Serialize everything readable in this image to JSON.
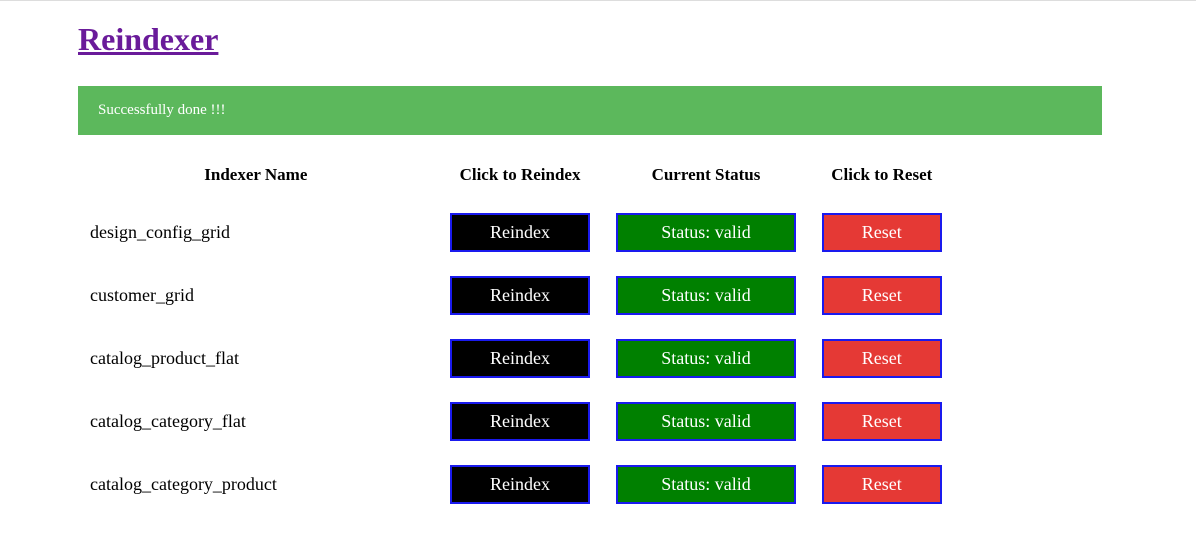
{
  "page": {
    "title": "Reindexer"
  },
  "banner": {
    "message": "Successfully done !!!"
  },
  "table": {
    "headers": {
      "name": "Indexer Name",
      "reindex": "Click to Reindex",
      "status": "Current Status",
      "reset": "Click to Reset"
    },
    "reindex_label": "Reindex",
    "reset_label": "Reset",
    "status_prefix": "Status: ",
    "rows": [
      {
        "name": "design_config_grid",
        "status": "valid"
      },
      {
        "name": "customer_grid",
        "status": "valid"
      },
      {
        "name": "catalog_product_flat",
        "status": "valid"
      },
      {
        "name": "catalog_category_flat",
        "status": "valid"
      },
      {
        "name": "catalog_category_product",
        "status": "valid"
      }
    ]
  }
}
